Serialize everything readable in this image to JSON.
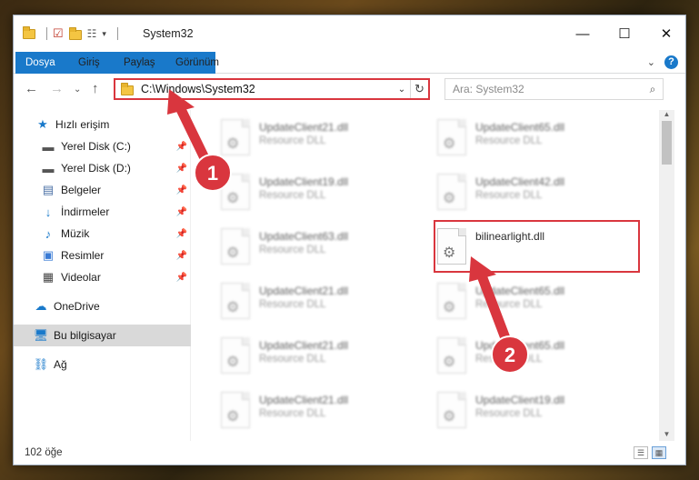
{
  "window": {
    "title": "System32",
    "controls": {
      "minimize": "—",
      "maximize": "☐",
      "close": "✕"
    }
  },
  "ribbon": {
    "tabs": [
      "Dosya",
      "Giriş",
      "Paylaş",
      "Görünüm"
    ],
    "help": "?",
    "expand": "⌄"
  },
  "nav": {
    "back": "←",
    "forward": "→",
    "recent": "⌄",
    "up": "↑",
    "address": "C:\\Windows\\System32",
    "address_chevron": "⌄",
    "refresh": "↻",
    "search_placeholder": "Ara: System32",
    "search_icon": "⌕"
  },
  "sidebar": {
    "quick_access": "Hızlı erişim",
    "items": [
      {
        "label": "Yerel Disk (C:)",
        "icon": "drive-icon",
        "pinned": true
      },
      {
        "label": "Yerel Disk (D:)",
        "icon": "drive-icon",
        "pinned": true
      },
      {
        "label": "Belgeler",
        "icon": "documents-icon",
        "pinned": true
      },
      {
        "label": "İndirmeler",
        "icon": "download-icon",
        "pinned": true
      },
      {
        "label": "Müzik",
        "icon": "music-icon",
        "pinned": true
      },
      {
        "label": "Resimler",
        "icon": "pictures-icon",
        "pinned": true
      },
      {
        "label": "Videolar",
        "icon": "videos-icon",
        "pinned": true
      }
    ],
    "onedrive": "OneDrive",
    "this_pc": "Bu bilgisayar",
    "network": "Ağ",
    "pin_glyph": "📌"
  },
  "files": [
    {
      "name": "UpdateClient21.dll",
      "desc": "Resource DLL",
      "blurred": true
    },
    {
      "name": "UpdateClient65.dll",
      "desc": "Resource DLL",
      "blurred": true
    },
    {
      "name": "UpdateClient19.dll",
      "desc": "Resource DLL",
      "blurred": true
    },
    {
      "name": "UpdateClient42.dll",
      "desc": "Resource DLL",
      "blurred": true
    },
    {
      "name": "UpdateClient63.dll",
      "desc": "Resource DLL",
      "blurred": true
    },
    {
      "name": "bilinearlight.dll",
      "desc": "",
      "blurred": false
    },
    {
      "name": "UpdateClient21.dll",
      "desc": "Resource DLL",
      "blurred": true
    },
    {
      "name": "UpdateClient65.dll",
      "desc": "Resource DLL",
      "blurred": true
    },
    {
      "name": "UpdateClient21.dll",
      "desc": "Resource DLL",
      "blurred": true
    },
    {
      "name": "UpdateClient65.dll",
      "desc": "Resource DLL",
      "blurred": true
    },
    {
      "name": "UpdateClient21.dll",
      "desc": "Resource DLL",
      "blurred": true
    },
    {
      "name": "UpdateClient19.dll",
      "desc": "Resource DLL",
      "blurred": true
    }
  ],
  "status": {
    "item_count": "102 öğe"
  },
  "annotations": {
    "step1": "1",
    "step2": "2",
    "color": "#d9363e"
  },
  "colors": {
    "accent": "#1979ca",
    "highlight": "#d9363e",
    "selected": "#d9d9d9"
  }
}
